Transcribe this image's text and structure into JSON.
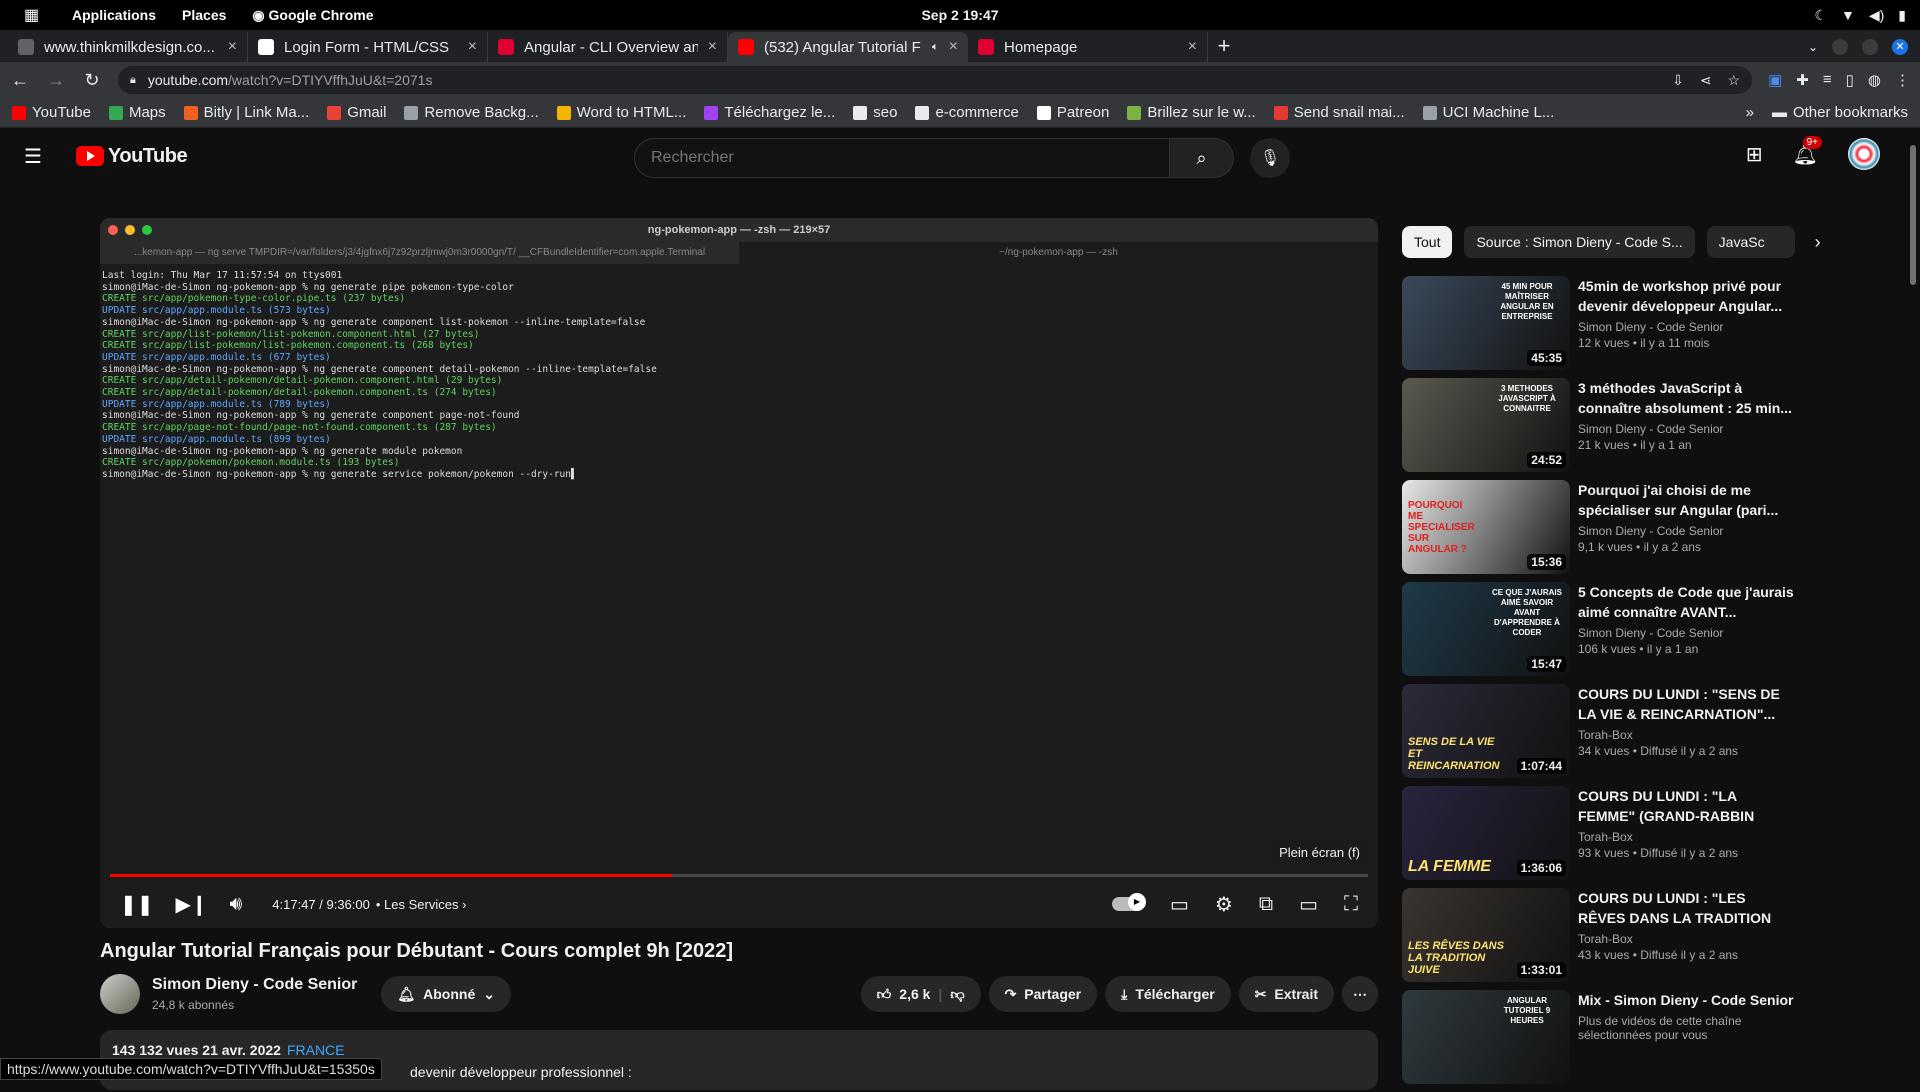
{
  "system": {
    "applications": "Applications",
    "places": "Places",
    "browser": "Google Chrome",
    "clock": "Sep 2  19:47"
  },
  "tabs": [
    {
      "title": "www.thinkmilkdesign.co...",
      "icon": "globe-icon",
      "color": "#5f6368"
    },
    {
      "title": "Login Form - HTML/CSS",
      "icon": "codepen-icon",
      "color": "#ffffff"
    },
    {
      "title": "Angular - CLI Overview an",
      "icon": "angular-icon",
      "color": "#dd0031"
    },
    {
      "title": "(532) Angular Tutorial F",
      "icon": "youtube-icon",
      "color": "#ff0000"
    },
    {
      "title": "Homepage",
      "icon": "angular-icon",
      "color": "#dd0031"
    }
  ],
  "address": {
    "host": "youtube.com",
    "path": "/watch?v=DTIYVffhJuU&t=2071s"
  },
  "bookmarks": [
    {
      "label": "YouTube",
      "color": "#ff0000"
    },
    {
      "label": "Maps",
      "color": "#34a853"
    },
    {
      "label": "Bitly | Link Ma...",
      "color": "#ee6123"
    },
    {
      "label": "Gmail",
      "color": "#ea4335"
    },
    {
      "label": "Remove Backg...",
      "color": "#9aa0a6"
    },
    {
      "label": "Word to HTML...",
      "color": "#f4b400"
    },
    {
      "label": "Téléchargez le...",
      "color": "#a142f4"
    },
    {
      "label": "seo",
      "color": "#e8eaed"
    },
    {
      "label": "e-commerce",
      "color": "#e8eaed"
    },
    {
      "label": "Patreon",
      "color": "#ffffff"
    },
    {
      "label": "Brillez sur le w...",
      "color": "#7cb342"
    },
    {
      "label": "Send snail mai...",
      "color": "#e53935"
    },
    {
      "label": "UCI Machine L...",
      "color": "#9aa0a6"
    }
  ],
  "bookmarks_more": "»",
  "other_bookmarks": "Other bookmarks",
  "youtube": {
    "logo": "YouTube",
    "search_placeholder": "Rechercher",
    "notif_count": "9+"
  },
  "terminal": {
    "title": "ng-pokemon-app — -zsh — 219×57",
    "tab1": "...kemon-app — ng serve TMPDIR=/var/folders/j3/4jgfnx6j7z92przljmwj0m3r0000gn/T/ __CFBundleIdentifier=com.apple.Terminal",
    "tab2": "~/ng-pokemon-app — -zsh",
    "lines": [
      {
        "t": "Last login: Thu Mar 17 11:57:54 on ttys001",
        "c": ""
      },
      {
        "t": "simon@iMac-de-Simon ng-pokemon-app % ng generate pipe pokemon-type-color",
        "c": ""
      },
      {
        "t": "CREATE src/app/pokemon-type-color.pipe.ts (237 bytes)",
        "c": "g"
      },
      {
        "t": "UPDATE src/app/app.module.ts (573 bytes)",
        "c": "b"
      },
      {
        "t": "simon@iMac-de-Simon ng-pokemon-app % ng generate component list-pokemon --inline-template=false",
        "c": ""
      },
      {
        "t": "CREATE src/app/list-pokemon/list-pokemon.component.html (27 bytes)",
        "c": "g"
      },
      {
        "t": "CREATE src/app/list-pokemon/list-pokemon.component.ts (268 bytes)",
        "c": "g"
      },
      {
        "t": "UPDATE src/app/app.module.ts (677 bytes)",
        "c": "b"
      },
      {
        "t": "simon@iMac-de-Simon ng-pokemon-app % ng generate component detail-pokemon --inline-template=false",
        "c": ""
      },
      {
        "t": "CREATE src/app/detail-pokemon/detail-pokemon.component.html (29 bytes)",
        "c": "g"
      },
      {
        "t": "CREATE src/app/detail-pokemon/detail-pokemon.component.ts (274 bytes)",
        "c": "g"
      },
      {
        "t": "UPDATE src/app/app.module.ts (789 bytes)",
        "c": "b"
      },
      {
        "t": "simon@iMac-de-Simon ng-pokemon-app % ng generate component page-not-found",
        "c": ""
      },
      {
        "t": "CREATE src/app/page-not-found/page-not-found.component.ts (287 bytes)",
        "c": "g"
      },
      {
        "t": "UPDATE src/app/app.module.ts (899 bytes)",
        "c": "b"
      },
      {
        "t": "simon@iMac-de-Simon ng-pokemon-app % ng generate module pokemon",
        "c": ""
      },
      {
        "t": "CREATE src/app/pokemon/pokemon.module.ts (193 bytes)",
        "c": "g"
      },
      {
        "t": "simon@iMac-de-Simon ng-pokemon-app % ng generate service pokemon/pokemon --dry-run▌",
        "c": ""
      }
    ]
  },
  "player": {
    "tooltip": "Plein écran (f)",
    "time": "4:17:47 / 9:36:00",
    "chapter": "• Les Services",
    "progress_fraction": 0.447
  },
  "video": {
    "title": "Angular Tutorial Français pour Débutant - Cours complet 9h [2022]",
    "channel": "Simon Dieny - Code Senior",
    "subscribers": "24,8 k abonnés",
    "subscribe_label": "Abonné",
    "likes": "2,6 k",
    "share": "Partager",
    "download": "Télécharger",
    "clip": "Extrait",
    "views_date": "143 132 vues  21 avr. 2022",
    "location_tag": "FRANCE",
    "desc_line": "devenir développeur professionnel :"
  },
  "status_url": "https://www.youtube.com/watch?v=DTIYVffhJuU&t=15350s",
  "chips": [
    "Tout",
    "Source : Simon Dieny - Code S...",
    "JavaSc"
  ],
  "recommendations": [
    {
      "title": "45min de workshop privé pour devenir développeur Angular...",
      "channel": "Simon Dieny - Code Senior",
      "stats": "12 k vues  • il y a 11 mois",
      "duration": "45:35",
      "caption": "45 MIN POUR MAÎTRISER ANGULAR EN ENTREPRISE",
      "big": "",
      "bg": "#3a4a5c"
    },
    {
      "title": "3 méthodes JavaScript à connaître absolument : 25 min...",
      "channel": "Simon Dieny - Code Senior",
      "stats": "21 k vues  • il y a 1 an",
      "duration": "24:52",
      "caption": "3 METHODES JAVASCRIPT À CONNAITRE",
      "big": "",
      "bg": "#5a5a50"
    },
    {
      "title": "Pourquoi j'ai choisi de me spécialiser sur Angular (pari...",
      "channel": "Simon Dieny - Code Senior",
      "stats": "9,1 k vues  • il y a 2 ans",
      "duration": "15:36",
      "caption": "",
      "big": "POURQUOI ME SPECIALISER SUR ANGULAR ?",
      "bg": "#e8e8e8"
    },
    {
      "title": "5 Concepts de Code que j'aurais aimé connaître AVANT...",
      "channel": "Simon Dieny - Code Senior",
      "stats": "106 k vues  • il y a 1 an",
      "duration": "15:47",
      "caption": "CE QUE J'AURAIS AIMÉ SAVOIR AVANT D'APPRENDRE À CODER",
      "big": "",
      "bg": "#1f3a4a"
    },
    {
      "title": "COURS DU LUNDI : \"SENS DE LA VIE & REINCARNATION\"...",
      "channel": "Torah-Box",
      "stats": "34 k vues  • Diffusé il y a 2 ans",
      "duration": "1:07:44",
      "caption": "",
      "big": "SENS DE LA VIE ET REINCARNATION",
      "bg": "#2b2a3a"
    },
    {
      "title": "COURS DU LUNDI : \"LA FEMME\" (GRAND-RABBIN JOSEPH-...",
      "channel": "Torah-Box",
      "stats": "93 k vues  • Diffusé il y a 2 ans",
      "duration": "1:36:06",
      "caption": "",
      "big": "LA FEMME",
      "bg": "#2a2440"
    },
    {
      "title": "COURS DU LUNDI : \"LES RÊVES DANS LA TRADITION JUIVE\"...",
      "channel": "Torah-Box",
      "stats": "43 k vues  • Diffusé il y a 2 ans",
      "duration": "1:33:01",
      "caption": "",
      "big": "LES RÊVES DANS LA TRADITION JUIVE",
      "bg": "#3a3530"
    },
    {
      "title": "Mix - Simon Dieny - Code Senior",
      "channel": "Plus de vidéos de cette chaîne sélectionnées pour vous",
      "stats": "",
      "duration": "",
      "caption": "ANGULAR TUTORIEL 9 HEURES",
      "big": "",
      "bg": "#2f3a3f"
    }
  ]
}
